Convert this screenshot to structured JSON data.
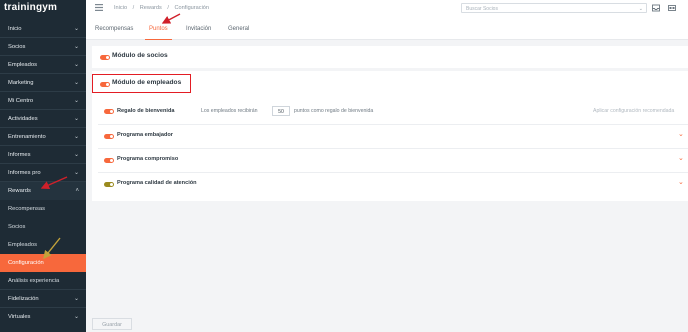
{
  "app": {
    "logo_text": "trainingym"
  },
  "sidebar": {
    "items_top": [
      {
        "label": "Inicio",
        "chevron": "⌄"
      },
      {
        "label": "Socios",
        "chevron": "⌄"
      },
      {
        "label": "Empleados",
        "chevron": "⌄"
      },
      {
        "label": "Marketing",
        "chevron": "⌄"
      },
      {
        "label": "Mi Centro",
        "chevron": "⌄"
      },
      {
        "label": "Actividades",
        "chevron": "⌄"
      },
      {
        "label": "Entrenamiento",
        "chevron": "⌄"
      },
      {
        "label": "Informes",
        "chevron": "⌄"
      },
      {
        "label": "Informes pro",
        "chevron": "⌄"
      },
      {
        "label": "Rewards",
        "chevron": "˄"
      }
    ],
    "rewards_sub": [
      {
        "label": "Recompensas"
      },
      {
        "label": "Socios"
      },
      {
        "label": "Empleados"
      },
      {
        "label": "Configuración"
      },
      {
        "label": "Análisis experiencia"
      }
    ],
    "items_bottom": [
      {
        "label": "Fidelización",
        "chevron": "⌄"
      },
      {
        "label": "Virtuales",
        "chevron": "⌄"
      }
    ]
  },
  "topbar": {
    "breadcrumb": [
      "Inicio",
      "/",
      "Rewards",
      "/",
      "Configuración"
    ],
    "search_placeholder": "Buscar Socios"
  },
  "tabs": [
    {
      "label": "Recompensas",
      "active": false
    },
    {
      "label": "Puntos",
      "active": true
    },
    {
      "label": "Invitación",
      "active": false
    },
    {
      "label": "General",
      "active": false
    }
  ],
  "main": {
    "module_socios": {
      "label": "Módulo de socios",
      "enabled": true
    },
    "module_empleados": {
      "label": "Módulo de empleados",
      "enabled": true
    },
    "regalo": {
      "label": "Regalo de bienvenida",
      "prefix": "Los empleados recibirán",
      "value": "50",
      "suffix": "puntos como regalo de bienvenida",
      "apply_link": "Aplicar configuración recomendada"
    },
    "programs": [
      {
        "label": "Programa embajador",
        "toggle_color": "#f7683c"
      },
      {
        "label": "Programa compromiso",
        "toggle_color": "#f7683c"
      },
      {
        "label": "Programa calidad de atención",
        "toggle_color": "#9a8a1e"
      }
    ],
    "save_label": "Guardar"
  },
  "colors": {
    "accent": "#f7683c",
    "sidebar": "#1e2b35",
    "highlight_box": "#e31d24",
    "annotation_arrow": "#d0202a"
  }
}
